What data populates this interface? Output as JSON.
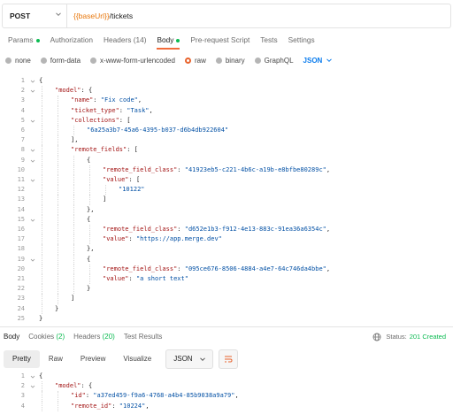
{
  "request": {
    "method": "POST",
    "url_var": "{{baseUrl}}",
    "url_path": "/tickets"
  },
  "request_tabs": [
    {
      "label": "Params",
      "dot": true
    },
    {
      "label": "Authorization"
    },
    {
      "label": "Headers",
      "count": "(14)"
    },
    {
      "label": "Body",
      "dot": true,
      "active": true
    },
    {
      "label": "Pre-request Script"
    },
    {
      "label": "Tests"
    },
    {
      "label": "Settings"
    }
  ],
  "body_types": [
    "none",
    "form-data",
    "x-www-form-urlencoded",
    "raw",
    "binary",
    "GraphQL"
  ],
  "body_selected": "raw",
  "body_format": "JSON",
  "request_body_lines": [
    {
      "n": "1",
      "indent": 0,
      "parts": [
        [
          "p",
          "{"
        ]
      ]
    },
    {
      "n": "2",
      "indent": 1,
      "parts": [
        [
          "k",
          "\"model\""
        ],
        [
          "p",
          ": {"
        ]
      ]
    },
    {
      "n": "3",
      "indent": 2,
      "parts": [
        [
          "k",
          "\"name\""
        ],
        [
          "p",
          ": "
        ],
        [
          "s",
          "\"Fix code\""
        ],
        [
          "p",
          ","
        ]
      ]
    },
    {
      "n": "4",
      "indent": 2,
      "parts": [
        [
          "k",
          "\"ticket_type\""
        ],
        [
          "p",
          ": "
        ],
        [
          "s",
          "\"Task\""
        ],
        [
          "p",
          ","
        ]
      ]
    },
    {
      "n": "5",
      "indent": 2,
      "parts": [
        [
          "k",
          "\"collections\""
        ],
        [
          "p",
          ": ["
        ]
      ]
    },
    {
      "n": "6",
      "indent": 3,
      "parts": [
        [
          "s",
          "\"6a25a3b7-45a6-4395-b037-d6b4db922604\""
        ]
      ]
    },
    {
      "n": "7",
      "indent": 2,
      "parts": [
        [
          "p",
          "],"
        ]
      ]
    },
    {
      "n": "8",
      "indent": 2,
      "parts": [
        [
          "k",
          "\"remote_fields\""
        ],
        [
          "p",
          ": ["
        ]
      ]
    },
    {
      "n": "9",
      "indent": 3,
      "parts": [
        [
          "p",
          "{"
        ]
      ]
    },
    {
      "n": "10",
      "indent": 4,
      "parts": [
        [
          "k",
          "\"remote_field_class\""
        ],
        [
          "p",
          ": "
        ],
        [
          "s",
          "\"41923eb5-c221-4b6c-a19b-e8bfbe80289c\""
        ],
        [
          "p",
          ","
        ]
      ]
    },
    {
      "n": "11",
      "indent": 4,
      "parts": [
        [
          "k",
          "\"value\""
        ],
        [
          "p",
          ": ["
        ]
      ]
    },
    {
      "n": "12",
      "indent": 5,
      "parts": [
        [
          "s",
          "\"10122\""
        ]
      ]
    },
    {
      "n": "13",
      "indent": 4,
      "parts": [
        [
          "p",
          "]"
        ]
      ]
    },
    {
      "n": "14",
      "indent": 3,
      "parts": [
        [
          "p",
          "},"
        ]
      ]
    },
    {
      "n": "15",
      "indent": 3,
      "parts": [
        [
          "p",
          "{"
        ]
      ]
    },
    {
      "n": "16",
      "indent": 4,
      "parts": [
        [
          "k",
          "\"remote_field_class\""
        ],
        [
          "p",
          ": "
        ],
        [
          "s",
          "\"d652e1b3-f912-4e13-883c-91ea36a6354c\""
        ],
        [
          "p",
          ","
        ]
      ]
    },
    {
      "n": "17",
      "indent": 4,
      "parts": [
        [
          "k",
          "\"value\""
        ],
        [
          "p",
          ": "
        ],
        [
          "s",
          "\"https://app.merge.dev\""
        ]
      ]
    },
    {
      "n": "18",
      "indent": 3,
      "parts": [
        [
          "p",
          "},"
        ]
      ]
    },
    {
      "n": "19",
      "indent": 3,
      "parts": [
        [
          "p",
          "{"
        ]
      ]
    },
    {
      "n": "20",
      "indent": 4,
      "parts": [
        [
          "k",
          "\"remote_field_class\""
        ],
        [
          "p",
          ": "
        ],
        [
          "s",
          "\"095ce676-8506-4884-a4e7-64c746da4bbe\""
        ],
        [
          "p",
          ","
        ]
      ]
    },
    {
      "n": "21",
      "indent": 4,
      "parts": [
        [
          "k",
          "\"value\""
        ],
        [
          "p",
          ": "
        ],
        [
          "s",
          "\"a short text\""
        ]
      ]
    },
    {
      "n": "22",
      "indent": 3,
      "parts": [
        [
          "p",
          "}"
        ]
      ]
    },
    {
      "n": "23",
      "indent": 2,
      "parts": [
        [
          "p",
          "]"
        ]
      ]
    },
    {
      "n": "24",
      "indent": 1,
      "parts": [
        [
          "p",
          "}"
        ]
      ]
    },
    {
      "n": "25",
      "indent": 0,
      "parts": [
        [
          "p",
          "}"
        ]
      ]
    }
  ],
  "response_tabs": [
    {
      "label": "Body",
      "active": true
    },
    {
      "label": "Cookies",
      "count": "(2)"
    },
    {
      "label": "Headers",
      "count": "(20)"
    },
    {
      "label": "Test Results"
    }
  ],
  "status": {
    "label": "Status:",
    "value": "201 Created"
  },
  "view_modes": [
    "Pretty",
    "Raw",
    "Preview",
    "Visualize"
  ],
  "view_selected": "Pretty",
  "response_format": "JSON",
  "response_lines": [
    {
      "n": "1",
      "indent": 0,
      "parts": [
        [
          "p",
          "{"
        ]
      ]
    },
    {
      "n": "2",
      "indent": 1,
      "parts": [
        [
          "k",
          "\"model\""
        ],
        [
          "p",
          ": {"
        ]
      ]
    },
    {
      "n": "3",
      "indent": 2,
      "parts": [
        [
          "k",
          "\"id\""
        ],
        [
          "p",
          ": "
        ],
        [
          "s",
          "\"a37ed459-f9a6-4768-a4b4-85b9038a9a79\""
        ],
        [
          "p",
          ","
        ]
      ]
    },
    {
      "n": "4",
      "indent": 2,
      "parts": [
        [
          "k",
          "\"remote_id\""
        ],
        [
          "p",
          ": "
        ],
        [
          "s",
          "\"10224\""
        ],
        [
          "p",
          ","
        ]
      ]
    }
  ],
  "colors": {
    "accent": "#f26b3a",
    "green": "#0cbb52",
    "blue": "#097bed",
    "key": "#a31515",
    "string": "#0451a5"
  }
}
